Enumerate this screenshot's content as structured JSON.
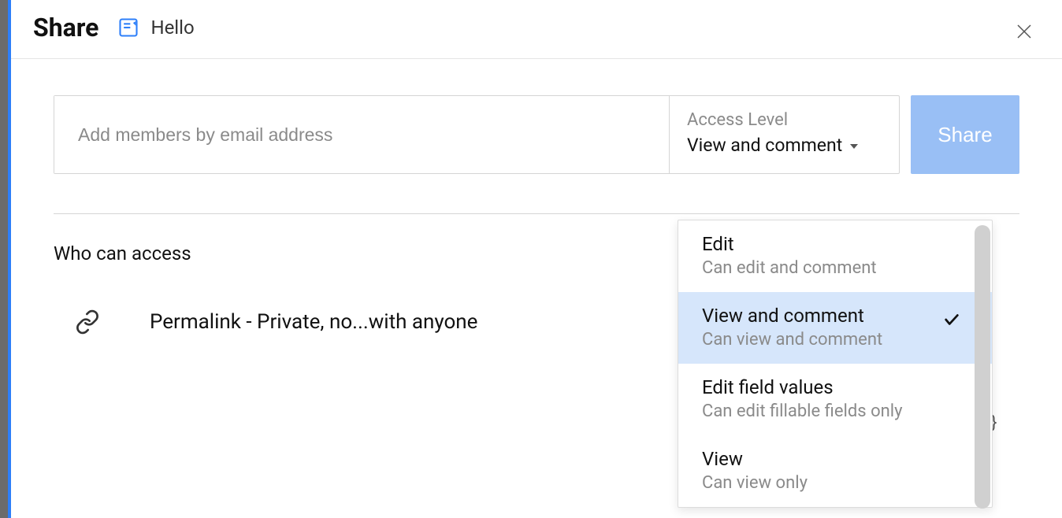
{
  "header": {
    "title": "Share",
    "doc_name": "Hello"
  },
  "invite": {
    "placeholder": "Add members by email address",
    "access_label": "Access Level",
    "access_value": "View and comment",
    "share_button": "Share"
  },
  "who_can_access": {
    "title": "Who can access",
    "permalink": "Permalink - Private, no...with anyone",
    "change_fragment": "}"
  },
  "dropdown": {
    "items": [
      {
        "title": "Edit",
        "desc": "Can edit and comment",
        "selected": false
      },
      {
        "title": "View and comment",
        "desc": "Can view and comment",
        "selected": true
      },
      {
        "title": "Edit field values",
        "desc": "Can edit fillable fields only",
        "selected": false
      },
      {
        "title": "View",
        "desc": "Can view only",
        "selected": false
      }
    ]
  }
}
